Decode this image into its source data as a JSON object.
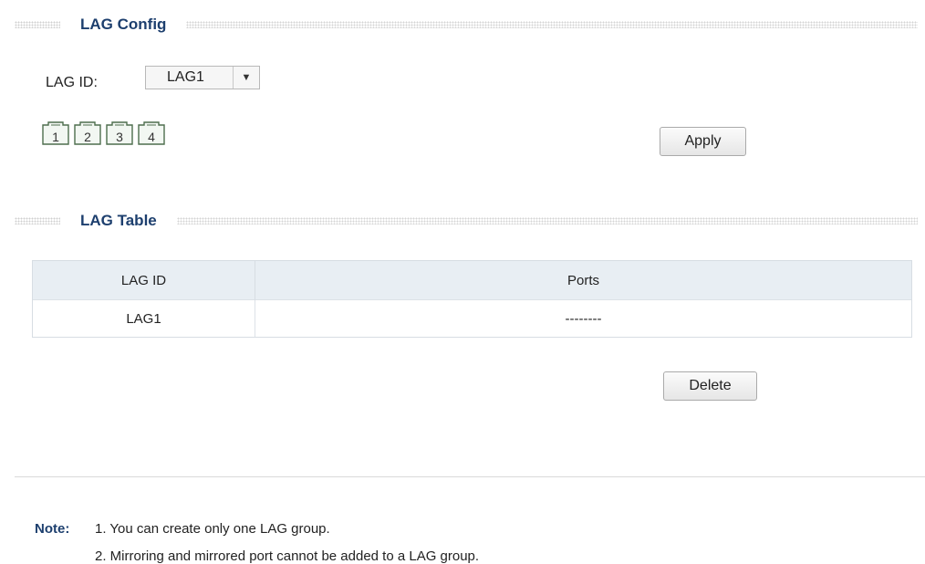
{
  "config_section": {
    "title": "LAG Config"
  },
  "lag_id": {
    "label": "LAG ID:",
    "selected": "LAG1"
  },
  "ports": [
    "1",
    "2",
    "3",
    "4"
  ],
  "apply_label": "Apply",
  "table_section": {
    "title": "LAG Table"
  },
  "table": {
    "headers": [
      "LAG ID",
      "Ports"
    ],
    "rows": [
      {
        "lag_id": "LAG1",
        "ports": "--------"
      }
    ]
  },
  "delete_label": "Delete",
  "note": {
    "label": "Note:",
    "lines": [
      "1. You can create only one LAG group.",
      "2. Mirroring and mirrored port cannot be added to a LAG group."
    ]
  }
}
